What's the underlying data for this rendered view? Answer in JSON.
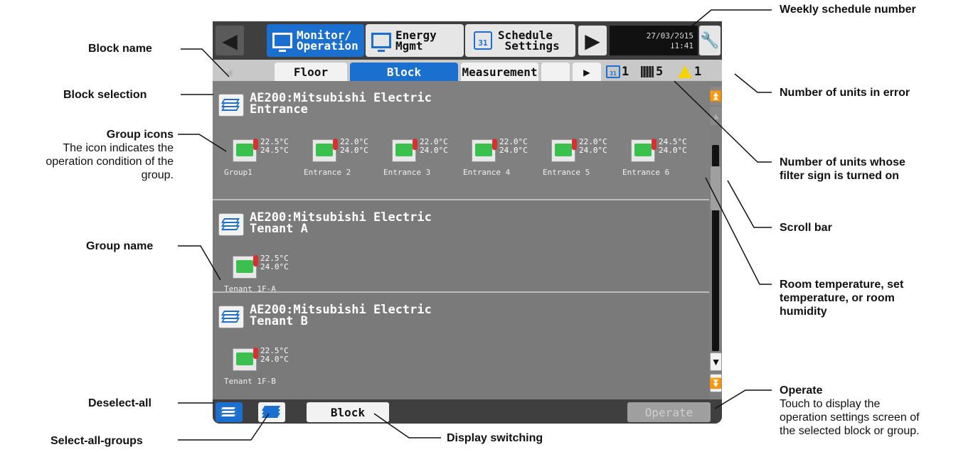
{
  "top_tabs": [
    {
      "label": "Monitor/\nOperation"
    },
    {
      "label": "Energy\nMgmt"
    },
    {
      "label": "Schedule\n Settings"
    }
  ],
  "schedule_icon_text": "31",
  "datetime": {
    "date": "27/03/2015",
    "time": "11:41"
  },
  "sub_tabs": {
    "floor": "Floor",
    "block": "Block",
    "measurement": "Measurement"
  },
  "status": {
    "schedule_number": "1",
    "filter_count": "5",
    "error_count": "1"
  },
  "blocks": [
    {
      "name": "AE200:Mitsubishi Electric\nEntrance",
      "units": [
        {
          "name": "Group1",
          "temps": "22.5°C\n24.5°C"
        },
        {
          "name": "Entrance 2",
          "temps": "22.0°C\n24.0°C"
        },
        {
          "name": "Entrance 3",
          "temps": "22.0°C\n24.0°C"
        },
        {
          "name": "Entrance 4",
          "temps": "22.0°C\n24.0°C"
        },
        {
          "name": "Entrance 5",
          "temps": "22.0°C\n24.0°C"
        },
        {
          "name": "Entrance 6",
          "temps": "24.5°C\n24.0°C"
        }
      ]
    },
    {
      "name": "AE200:Mitsubishi Electric\nTenant A",
      "units": [
        {
          "name": "Tenant 1F-A",
          "temps": "22.5°C\n24.0°C"
        }
      ]
    },
    {
      "name": "AE200:Mitsubishi Electric\nTenant B",
      "units": [
        {
          "name": "Tenant 1F-B",
          "temps": "22.5°C\n24.0°C"
        }
      ]
    }
  ],
  "bottom": {
    "block_button": "Block",
    "operate_button": "Operate"
  },
  "icons": {
    "prev": "left-triangle-icon",
    "next": "right-triangle-icon",
    "settings": "wrench-icon",
    "scroll_down": "down-triangle-icon",
    "scroll_bottom": "double-down-icon"
  },
  "colors": {
    "accent": "#1a6fcf",
    "unit_green": "#3bbf4f",
    "warning": "#f5d300"
  },
  "annotations": {
    "block_name": "Block name",
    "block_selection": "Block selection",
    "group_icons": "Group icons",
    "group_icons_desc": "The icon indicates the\noperation condition of the\ngroup.",
    "group_name": "Group name",
    "deselect_all": "Deselect-all",
    "select_all_groups": "Select-all-groups",
    "display_switching": "Display switching",
    "weekly_schedule": "Weekly schedule number",
    "units_in_error": "Number of units in error",
    "filter_units": "Number of units whose\nfilter sign is turned on",
    "scroll_bar": "Scroll bar",
    "room_temp": "Room temperature, set\ntemperature, or room\nhumidity",
    "operate": "Operate",
    "operate_desc": "Touch to display the\noperation settings screen of\nthe selected block or group."
  }
}
